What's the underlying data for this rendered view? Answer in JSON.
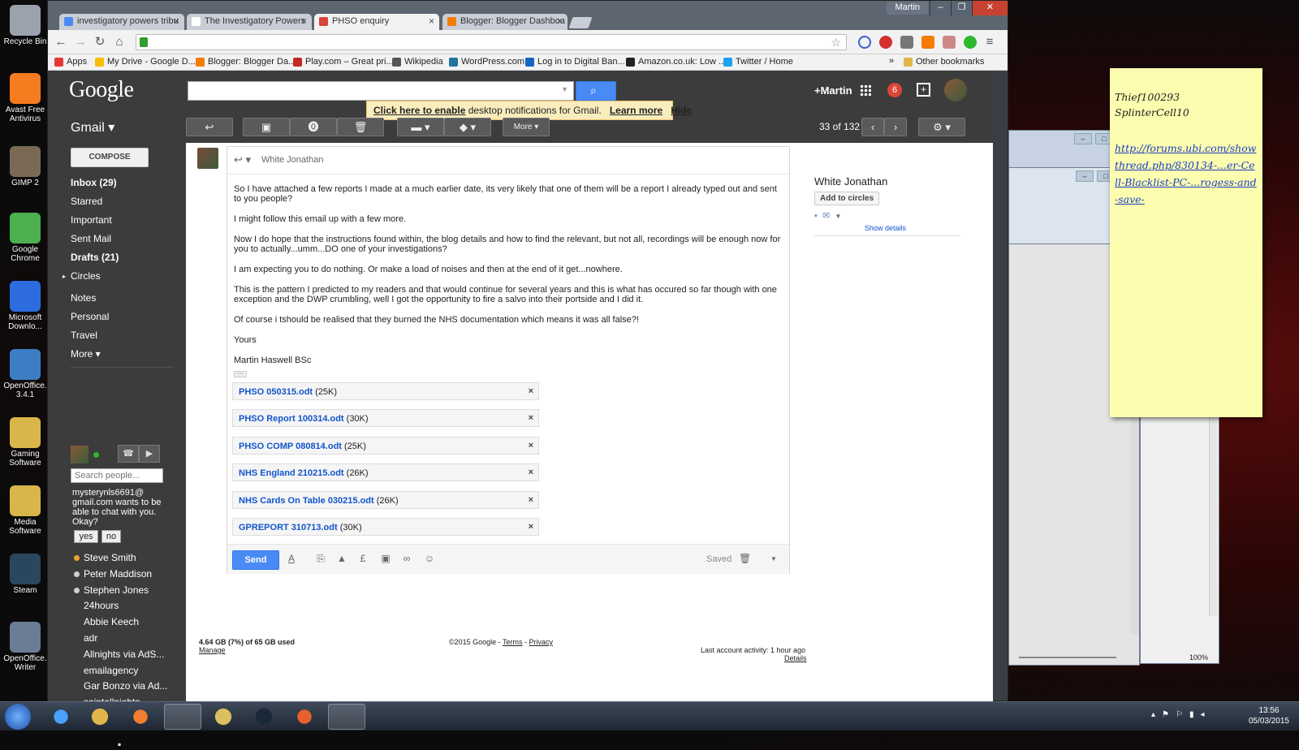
{
  "desktop": {
    "icons": [
      {
        "label": "Recycle Bin",
        "icon": "recycle-bin-icon",
        "color": "#9aa3ad"
      },
      {
        "label": "Avast Free Antivirus",
        "icon": "avast-icon",
        "color": "#f57c1f"
      },
      {
        "label": "GIMP 2",
        "icon": "gimp-icon",
        "color": "#7a6a55"
      },
      {
        "label": "Google Chrome",
        "icon": "chrome-icon",
        "color": "#4caf50"
      },
      {
        "label": "Microsoft Downlo...",
        "icon": "download-icon",
        "color": "#2d6cdf"
      },
      {
        "label": "OpenOffice. 3.4.1",
        "icon": "openoffice-icon",
        "color": "#3c7dc4"
      },
      {
        "label": "Gaming Software",
        "icon": "folder-icon",
        "color": "#d9b64a"
      },
      {
        "label": "Media Software",
        "icon": "folder-icon",
        "color": "#d9b64a"
      },
      {
        "label": "Steam",
        "icon": "steam-icon",
        "color": "#2a475e"
      },
      {
        "label": "OpenOffice. Writer",
        "icon": "writer-icon",
        "color": "#6a7d95"
      }
    ]
  },
  "browser": {
    "profile_name": "Martin",
    "tabs": [
      {
        "title": "investigatory powers tribu",
        "fav_color": "#4a8af4",
        "active": false
      },
      {
        "title": "The Investigatory Powers",
        "fav_color": "#ffffff",
        "active": false
      },
      {
        "title": "PHSO enquiry",
        "fav_color": "#d44638",
        "active": true
      },
      {
        "title": "Blogger: Blogger Dashboa",
        "fav_color": "#f57c00",
        "active": false
      }
    ],
    "bookmarks": [
      {
        "label": "Apps",
        "color": "#e53935"
      },
      {
        "label": "My Drive - Google D...",
        "color": "#fbbc05"
      },
      {
        "label": "Blogger: Blogger Da...",
        "color": "#f57c00"
      },
      {
        "label": "Play.com – Great pri...",
        "color": "#c62828"
      },
      {
        "label": "Wikipedia",
        "color": "#555555"
      },
      {
        "label": "WordPress.com",
        "color": "#21759b"
      },
      {
        "label": "Log in to Digital Ban...",
        "color": "#1565c0"
      },
      {
        "label": "Amazon.co.uk: Low ...",
        "color": "#222222"
      },
      {
        "label": "Twitter / Home",
        "color": "#1da1f2"
      },
      {
        "label": "Other bookmarks",
        "color": "#e0b64a"
      }
    ],
    "overflow_label": "»"
  },
  "gmail": {
    "logo": "Google",
    "plus_user": "+Martin",
    "notification_count": "6",
    "banner": {
      "link": "Click here to enable",
      "text": " desktop notifications for Gmail.",
      "learn_more": "Learn more",
      "hide": "Hide"
    },
    "app_label": "Gmail ▾",
    "more_label": "More ▾",
    "page_count": "33 of 132",
    "compose_label": "COMPOSE",
    "nav": [
      {
        "label": "Inbox (29)",
        "bold": true
      },
      {
        "label": "Starred",
        "bold": false
      },
      {
        "label": "Important",
        "bold": false
      },
      {
        "label": "Sent Mail",
        "bold": false
      },
      {
        "label": "Drafts (21)",
        "bold": true
      },
      {
        "label": "Circles",
        "bold": false
      },
      {
        "label": "Notes",
        "bold": false
      },
      {
        "label": "Personal",
        "bold": false
      },
      {
        "label": "Travel",
        "bold": false
      },
      {
        "label": "More ▾",
        "bold": false
      }
    ],
    "chat": {
      "search_placeholder": "Search people...",
      "invite_text": "mysterynls6691@ gmail.com wants to be able to chat with you. Okay?",
      "yes_label": "yes",
      "no_label": "no",
      "contacts": [
        {
          "name": "Steve Smith",
          "status_color": "#f0a030"
        },
        {
          "name": "Peter Maddison",
          "status_color": "#cfcfcf"
        },
        {
          "name": "Stephen Jones",
          "status_color": "#cfcfcf"
        },
        {
          "name": "24hours",
          "status_color": ""
        },
        {
          "name": "Abbie Keech",
          "status_color": ""
        },
        {
          "name": "adr",
          "status_color": ""
        },
        {
          "name": "Allnights via AdS...",
          "status_color": ""
        },
        {
          "name": "emailagency",
          "status_color": ""
        },
        {
          "name": "Gar Bonzo via Ad...",
          "status_color": ""
        },
        {
          "name": "saintallnights",
          "status_color": ""
        }
      ]
    },
    "reply": {
      "to": "White Jonathan",
      "body": [
        "So I have attached a few reports I made at a much earlier date, its very likely that one of them will be a report I already typed out and sent to you people?",
        "I might follow this email up with a few more.",
        "Now I do hope that the instructions found within, the blog details and how to find the relevant, but not all, recordings will be enough now for you to actually...umm...DO one of your investigations?",
        "I am expecting you to do nothing. Or make a load of noises and then at the end of it get...nowhere.",
        "This is the pattern I predicted to my readers and that would continue for several years and this is what has occured so far though with one exception and the DWP crumbling, well I got the opportunity to fire a salvo into their portside and I did it.",
        "Of course i tshould be realised that they burned the NHS documentation which means it was all false?!",
        "Yours",
        "Martin Haswell BSc"
      ],
      "ellipsis": "···",
      "attachments": [
        {
          "name": "PHSO 050315.odt",
          "size": "(25K)"
        },
        {
          "name": "PHSO Report 100314.odt",
          "size": "(30K)"
        },
        {
          "name": "PHSO COMP 080814.odt",
          "size": "(25K)"
        },
        {
          "name": "NHS England 210215.odt",
          "size": "(26K)"
        },
        {
          "name": "NHS Cards On Table 030215.odt",
          "size": "(26K)"
        },
        {
          "name": "GPREPORT 310713.odt",
          "size": "(30K)"
        }
      ],
      "send_label": "Send",
      "saved_label": "Saved"
    },
    "contact_card": {
      "name": "White Jonathan",
      "add_to_circles": "Add to circles",
      "show_details": "Show details"
    },
    "footer": {
      "storage": "4.64 GB (7%) of 65 GB used",
      "manage": "Manage",
      "copyright": "©2015 Google - ",
      "terms": "Terms",
      "sep": " - ",
      "privacy": "Privacy",
      "last_activity": "Last account activity: 1 hour ago",
      "details": "Details"
    }
  },
  "sticky_note": {
    "line1": "Thief100293",
    "line2": "SplinterCell10",
    "link": "http://forums.ubi.com/showthread.php/830134-...er-Cell-Blacklist-PC-...rogess-and-save-"
  },
  "background_window": {
    "zoom": "100%"
  },
  "taskbar": {
    "time": "13:56",
    "date": "05/03/2015"
  }
}
